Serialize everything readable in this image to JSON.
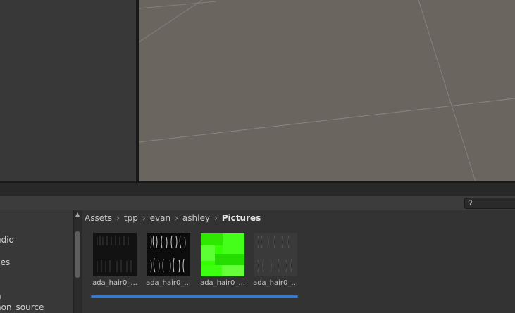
{
  "project_window": {
    "search": {
      "placeholder": "",
      "value": ""
    },
    "breadcrumb": [
      "Assets",
      "tpp",
      "evan",
      "ashley",
      "Pictures"
    ],
    "breadcrumb_separator": "›",
    "folder_tree": {
      "items": [
        "udio",
        "ces",
        "n",
        "hon_source"
      ]
    },
    "assets": [
      {
        "label": "ada_hair0_...",
        "type": "dark-hair-texture"
      },
      {
        "label": "ada_hair0_...",
        "type": "bright-hair-texture"
      },
      {
        "label": "ada_hair0_...",
        "type": "green-texture"
      },
      {
        "label": "ada_hair0_...",
        "type": "faded-hair-texture"
      }
    ]
  },
  "colors": {
    "selection_accent": "#3a79c7",
    "scene_background": "#6b6560",
    "panel_background": "#383838"
  },
  "icons": {
    "search": "search-icon",
    "scroll_up": "scroll-up-arrow-icon"
  }
}
